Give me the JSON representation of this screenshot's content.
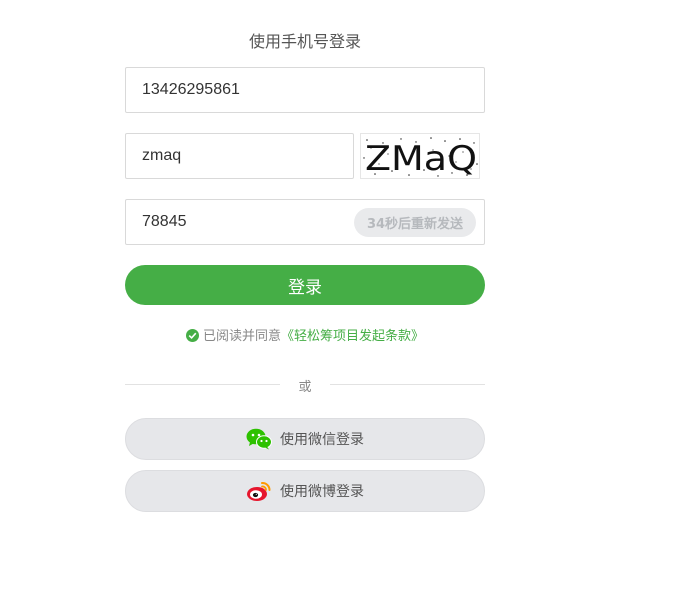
{
  "login": {
    "title": "使用手机号登录",
    "phone_value": "13426295861",
    "captcha_value": "zmaq",
    "captcha_image_text": "ZMaQ",
    "sms_code_value": "78845",
    "resend_label": "34秒后重新发送",
    "submit_label": "登录"
  },
  "agreement": {
    "prefix": "已阅读并同意",
    "link": "《轻松筹项目发起条款》"
  },
  "divider": {
    "label": "或"
  },
  "social": {
    "wechat_label": "使用微信登录",
    "weibo_label": "使用微博登录"
  },
  "colors": {
    "primary": "#45ae46",
    "button_gray": "#e6e7ea",
    "wechat": "#2dc100",
    "weibo": "#e6162d"
  },
  "icons": [
    "checkmark-icon",
    "wechat-icon",
    "weibo-icon"
  ]
}
